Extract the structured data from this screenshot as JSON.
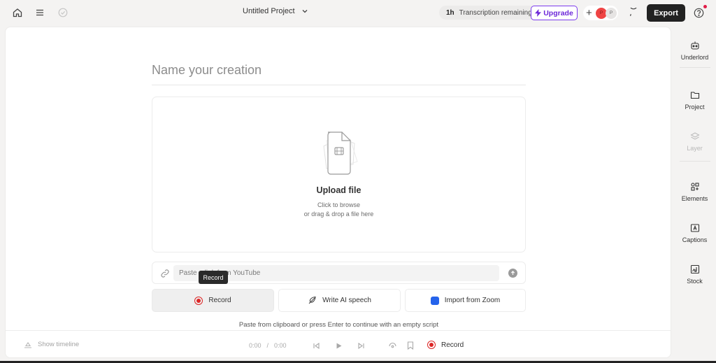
{
  "topbar": {
    "project_title": "Untitled Project",
    "transcription_amount": "1h",
    "transcription_label": "Transcription remaining",
    "upgrade_label": "Upgrade",
    "avatar_initial_1": "P",
    "avatar_initial_2": "P",
    "export_label": "Export"
  },
  "main": {
    "name_placeholder": "Name your creation",
    "upload_title": "Upload file",
    "upload_sub_1": "Click to browse",
    "upload_sub_2": "or drag & drop a file here",
    "link_placeholder": "Paste a link from YouTube",
    "tooltip": "Record",
    "buttons": {
      "record": "Record",
      "ai_speech": "Write AI speech",
      "zoom": "Import from Zoom"
    },
    "hint": "Paste from clipboard or press Enter to continue with an empty script"
  },
  "timeline": {
    "show_label": "Show timeline",
    "current_time": "0:00",
    "separator": "/",
    "total_time": "0:00",
    "record_label": "Record"
  },
  "sidebar": {
    "items": [
      {
        "label": "Underlord",
        "icon": "robot-icon",
        "enabled": true
      },
      {
        "label": "Project",
        "icon": "folder-icon",
        "enabled": true
      },
      {
        "label": "Layer",
        "icon": "layers-icon",
        "enabled": false
      },
      {
        "label": "Elements",
        "icon": "elements-icon",
        "enabled": true
      },
      {
        "label": "Captions",
        "icon": "captions-icon",
        "enabled": true
      },
      {
        "label": "Stock",
        "icon": "stock-icon",
        "enabled": true
      }
    ]
  },
  "colors": {
    "accent_purple": "#7c3aed",
    "record_red": "#dc2626",
    "zoom_blue": "#2563eb",
    "export_bg": "#222222"
  }
}
